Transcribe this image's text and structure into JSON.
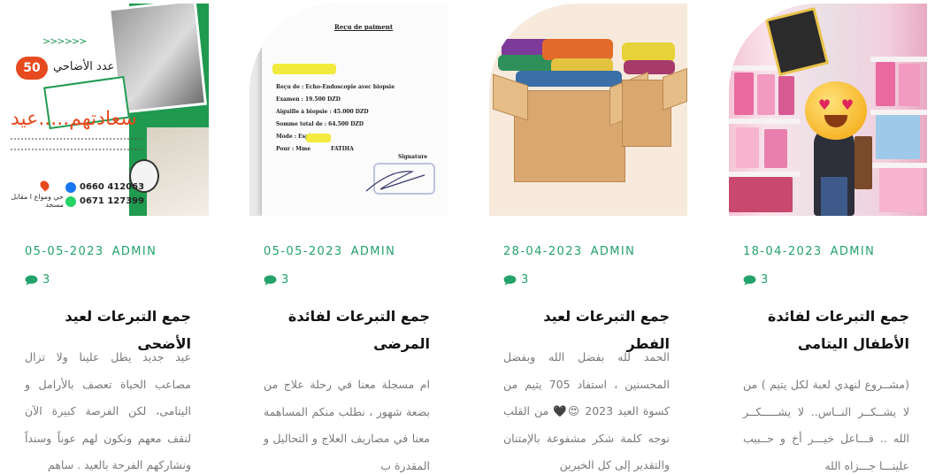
{
  "posts": [
    {
      "date": "05-05-2023",
      "author": "ADMIN",
      "comments": "3",
      "title": "جمع التبرعات لعيد الأضحى",
      "excerpt": "عيد جديد يطل علينا ولا تزال مصاعب الحياة تعصف بالأرامل و اليتامى، لكن الفرصة كبيرة الآن لنقف معهم ونكون لهم عوناً وسنداً ونشاركهم الفرحة بالعيد . ساهم",
      "image": {
        "headline": "عدد الأضاحي",
        "count": "50",
        "slogan": "سعادتهم.....عيد",
        "phone_1": "0660 412063",
        "phone_2": "0671 127399",
        "address": "حي ومواع ا مقابل مسجد",
        "arrows": ">>>>>>"
      }
    },
    {
      "date": "05-05-2023",
      "author": "ADMIN",
      "comments": "3",
      "title": "جمع التبرعات لفائدة المرضى",
      "excerpt": "ام مسجلة معنا في رحلة علاج من بضعة شهور ، نطلب منكم المساهمة معنا في مصاريف العلاج و التحاليل و المقدرة ب",
      "image": {
        "heading": "Reçu de paiment",
        "lines": [
          "Reçu de : Echo-Endoscopie avec biopsie",
          "Examen : 19.500 DZD",
          "Aiguille à biopsie : 45.000 DZD",
          "Somme total de : 64.500 DZD",
          "Mode : Espèce",
          "Pour : Mme           FATIHA"
        ],
        "signature": "Signature"
      }
    },
    {
      "date": "28-04-2023",
      "author": "ADMIN",
      "comments": "3",
      "title": "جمع التبرعات لعيد الفطر",
      "excerpt": "الحمد لله بفضل الله وبفضل المحسنين ، استفاد 705 يتيم من كسوة العيد 2023 😍🖤 من القلب نوجه كلمة شكر مشفوعة بالإمتنان والتقدير إلى كل الخيرين"
    },
    {
      "date": "18-04-2023",
      "author": "ADMIN",
      "comments": "3",
      "title": "جمع التبرعات لفائدة الأطفال اليتامى",
      "excerpt": "(مشــروع لنهدي لعبة لكل يتيم ) من لا يشــكــر النــاس.. لا يشـــــكــر الله .. فـــاعل خيـــر أخ و حــبيب علينـــا جـــزاه الله"
    }
  ],
  "colors": {
    "accent": "#23a26b",
    "title": "#111111",
    "excerpt": "#7a7a7a"
  },
  "icons": {
    "comments": "speech-bubble-icon"
  }
}
